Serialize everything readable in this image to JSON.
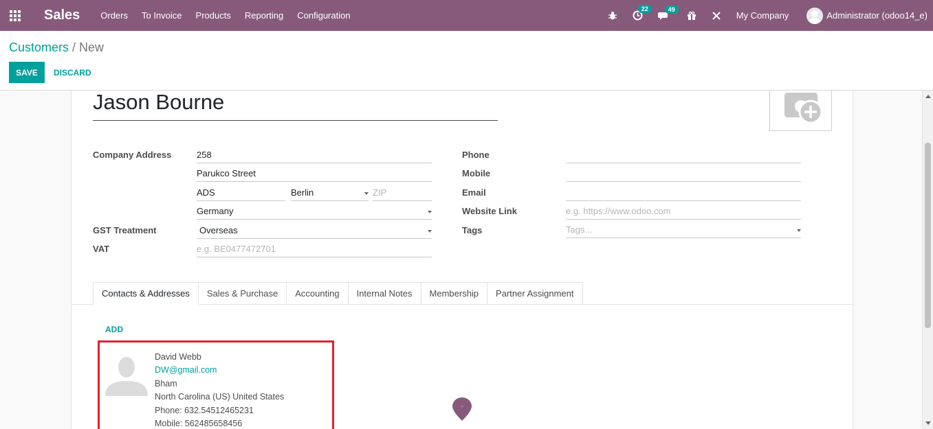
{
  "navbar": {
    "brand": "Sales",
    "menu": [
      "Orders",
      "To Invoice",
      "Products",
      "Reporting",
      "Configuration"
    ],
    "activity_count": "22",
    "message_count": "49",
    "company": "My Company",
    "user": "Administrator (odoo14_e)"
  },
  "breadcrumb": {
    "parent": "Customers",
    "separator": "/",
    "current": "New"
  },
  "buttons": {
    "save": "SAVE",
    "discard": "DISCARD"
  },
  "form": {
    "name": "Jason Bourne",
    "labels": {
      "company_address": "Company Address",
      "gst_treatment": "GST Treatment",
      "vat": "VAT",
      "phone": "Phone",
      "mobile": "Mobile",
      "email": "Email",
      "website": "Website Link",
      "tags": "Tags"
    },
    "address": {
      "street": "258",
      "street2": "Parukco Street",
      "city": "ADS",
      "state": "Berlin",
      "zip_placeholder": "ZIP",
      "country": "Germany"
    },
    "gst_treatment": "Overseas",
    "vat_placeholder": "e.g. BE0477472701",
    "website_placeholder": "e.g. https://www.odoo.com",
    "tags_placeholder": "Tags..."
  },
  "tabs": [
    "Contacts & Addresses",
    "Sales & Purchase",
    "Accounting",
    "Internal Notes",
    "Membership",
    "Partner Assignment"
  ],
  "contacts": {
    "add_label": "ADD",
    "card": {
      "name": "David Webb",
      "email": "DW@gmail.com",
      "city": "Bham",
      "region": "North Carolina (US) United States",
      "phone": "Phone: 632.54512465231",
      "mobile": "Mobile: 562485658456"
    }
  },
  "colors": {
    "navbar": "#875a7b",
    "accent": "#00a09d",
    "highlight": "#e1232b"
  }
}
